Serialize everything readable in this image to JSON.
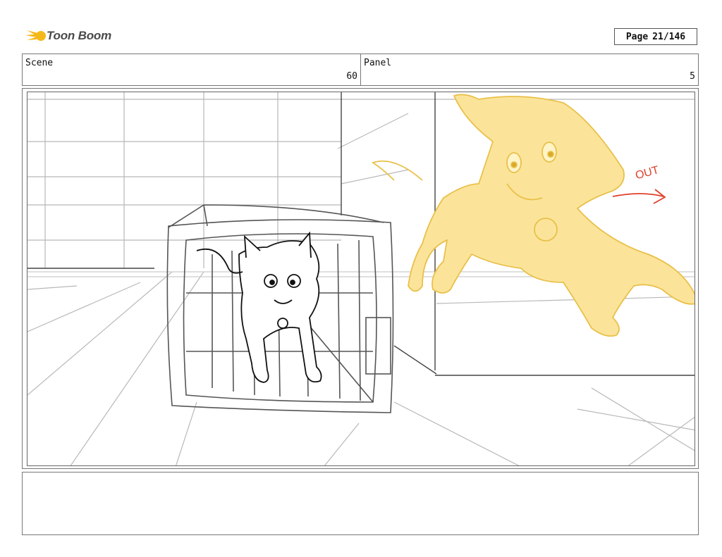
{
  "brand": {
    "name": "Toon Boom",
    "accent": "#f5b81b",
    "text_color": "#4a4a4a"
  },
  "page": {
    "label": "Page",
    "value": "21/146"
  },
  "scene": {
    "label": "Scene",
    "value": "60"
  },
  "panel": {
    "label": "Panel",
    "value": "5"
  },
  "drawing": {
    "annotation_text": "OUT",
    "annotation_color": "#e0402a",
    "highlight_color": "#fbe49a",
    "line_color": "#111111"
  },
  "notes": {
    "text": ""
  }
}
